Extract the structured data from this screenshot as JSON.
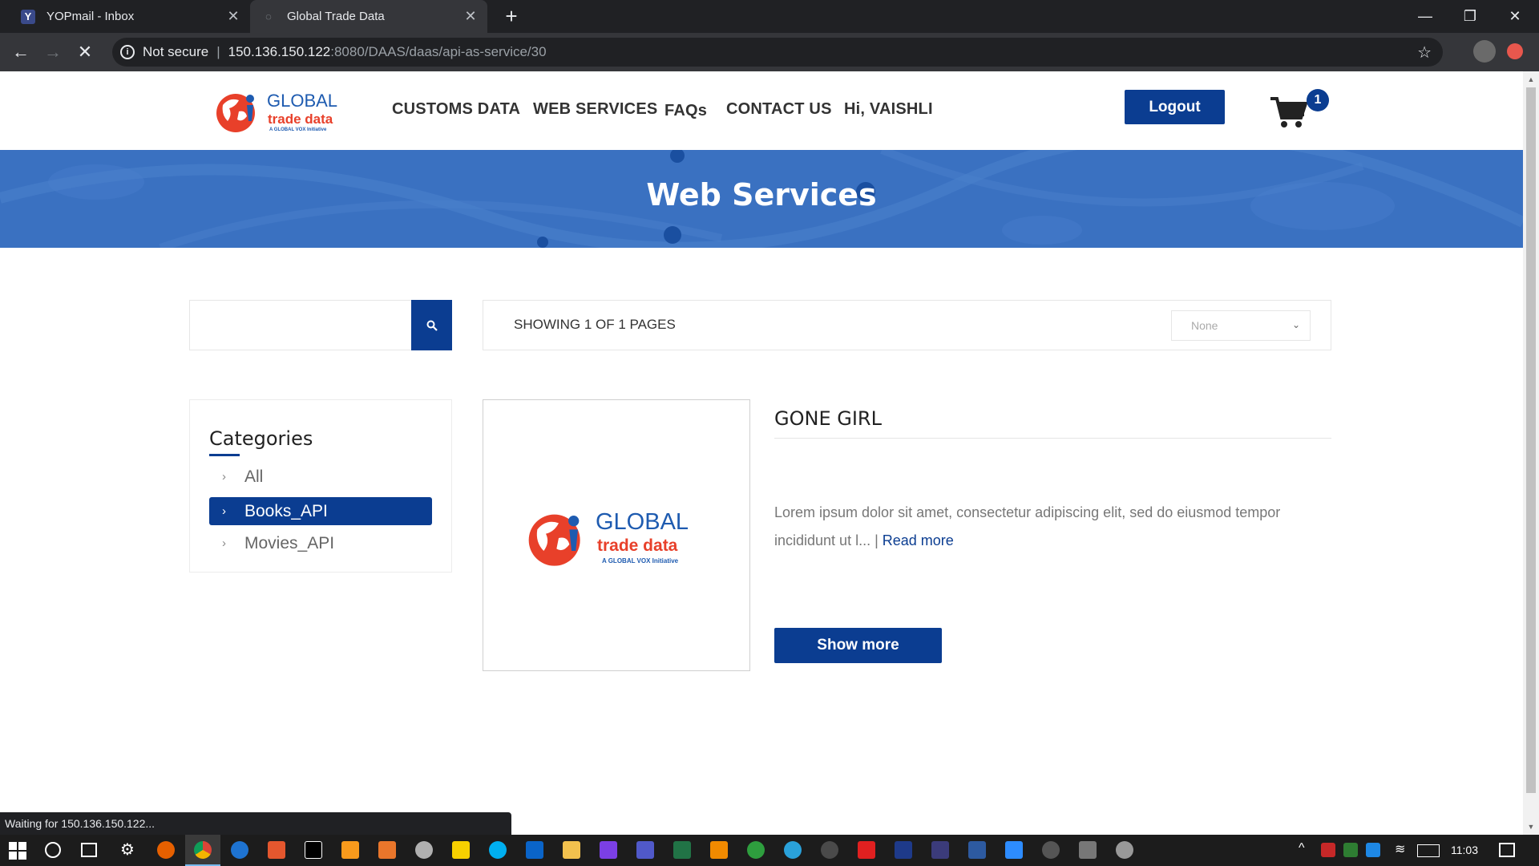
{
  "browser": {
    "tabs": [
      {
        "title": "YOPmail - Inbox",
        "active": false
      },
      {
        "title": "Global Trade Data",
        "active": true
      }
    ],
    "security_label": "Not secure",
    "url_host": "150.136.150.122",
    "url_rest": ":8080/DAAS/daas/api-as-service/30",
    "status_text": "Waiting for 150.136.150.122..."
  },
  "site": {
    "logo": {
      "line1": "GLOBAL",
      "line2": "trade data",
      "line3": "A GLOBAL VOX Initiative"
    },
    "nav": [
      "CUSTOMS DATA",
      "WEB SERVICES",
      "FAQs",
      "CONTACT US"
    ],
    "greeting": "Hi, VAISHLI",
    "logout_label": "Logout",
    "cart_count": "1"
  },
  "banner": {
    "title": "Web Services"
  },
  "toolbar": {
    "search_placeholder": "",
    "pager_text": "SHOWING 1 OF 1 PAGES",
    "sort_value": "None"
  },
  "categories": {
    "title": "Categories",
    "items": [
      {
        "label": "All",
        "active": false
      },
      {
        "label": "Books_API",
        "active": true
      },
      {
        "label": "Movies_API",
        "active": false
      }
    ]
  },
  "product": {
    "title": "GONE GIRL",
    "description": "Lorem ipsum dolor sit amet, consectetur adipiscing elit, sed do eiusmod tempor incididunt ut l... |",
    "read_more": "Read more",
    "button_label": "Show more"
  },
  "taskbar": {
    "time": "11:03"
  },
  "colors": {
    "brand": "#0b3d91",
    "banner": "#3a71c1",
    "logo_red": "#e8402a"
  }
}
